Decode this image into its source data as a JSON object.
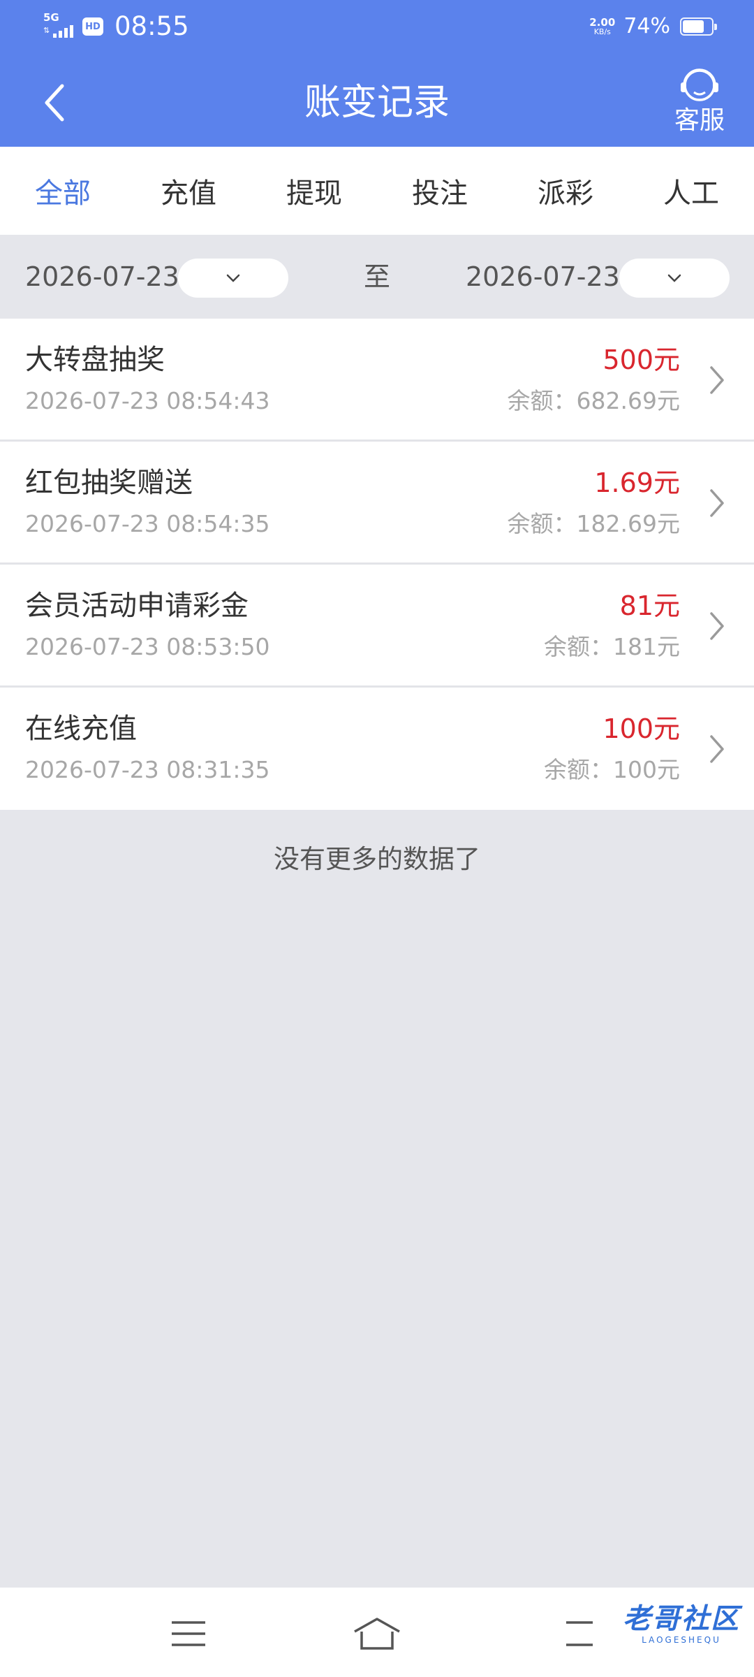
{
  "status_bar": {
    "network": "5G",
    "hd": "HD",
    "time": "08:55",
    "speed_value": "2.00",
    "speed_unit": "KB/s",
    "battery_percent": "74%",
    "battery_level": 0.74
  },
  "header": {
    "title": "账变记录",
    "service_label": "客服",
    "icons": {
      "back": "chevron-left-icon",
      "service": "headset-icon"
    }
  },
  "tabs": [
    {
      "label": "全部",
      "active": true
    },
    {
      "label": "充值",
      "active": false
    },
    {
      "label": "提现",
      "active": false
    },
    {
      "label": "投注",
      "active": false
    },
    {
      "label": "派彩",
      "active": false
    },
    {
      "label": "人工",
      "active": false
    }
  ],
  "date_filter": {
    "start_date": "2026-07-23",
    "separator": "至",
    "end_date": "2026-07-23"
  },
  "records": [
    {
      "title": "大转盘抽奖",
      "time": "2026-07-23 08:54:43",
      "amount": "500元",
      "balance": "余额：682.69元"
    },
    {
      "title": "红包抽奖赠送",
      "time": "2026-07-23 08:54:35",
      "amount": "1.69元",
      "balance": "余额：182.69元"
    },
    {
      "title": "会员活动申请彩金",
      "time": "2026-07-23 08:53:50",
      "amount": "81元",
      "balance": "余额：181元"
    },
    {
      "title": "在线充值",
      "time": "2026-07-23 08:31:35",
      "amount": "100元",
      "balance": "余额：100元"
    }
  ],
  "no_more_text": "没有更多的数据了",
  "watermark": {
    "text": "老哥社区",
    "sub": "LAOGESHEQU"
  },
  "colors": {
    "header_bg": "#5b82ec",
    "active_tab": "#4a78e0",
    "amount": "#d9262e",
    "page_bg": "#e5e6eb"
  }
}
